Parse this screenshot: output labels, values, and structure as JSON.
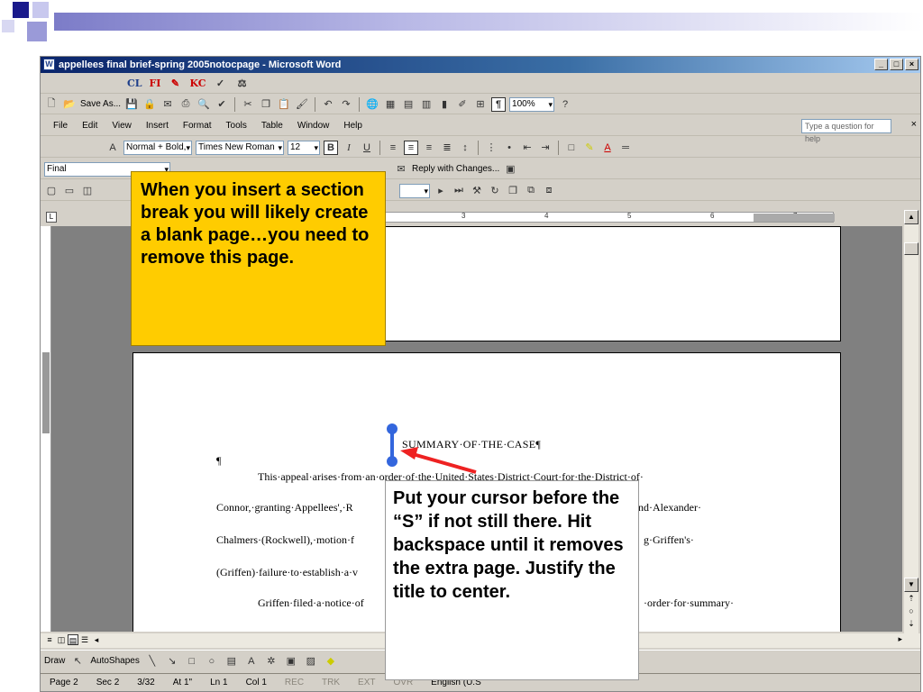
{
  "window": {
    "title": "appellees final brief-spring 2005notocpage - Microsoft Word",
    "min": "_",
    "max": "□",
    "close": "×"
  },
  "custom_toolbar": {
    "cl": "CL",
    "fi": "FI",
    "kc": "KC"
  },
  "standard_toolbar": {
    "save_as": "Save As...",
    "zoom": "100%"
  },
  "menu": [
    "File",
    "Edit",
    "View",
    "Insert",
    "Format",
    "Tools",
    "Table",
    "Window",
    "Help"
  ],
  "help": {
    "placeholder": "Type a question for help"
  },
  "format_toolbar": {
    "style": "Normal + Bold,",
    "font": "Times New Roman",
    "size": "12",
    "bold": "B",
    "italic": "I",
    "underline": "U"
  },
  "review_toolbar": {
    "display": "Final",
    "reply": "Reply with Changes..."
  },
  "ruler": {
    "marks": [
      "3",
      "4",
      "5",
      "6",
      "7"
    ]
  },
  "document": {
    "pilcrow": "¶",
    "title": "SUMMARY·OF·THE·CASE¶",
    "lines": [
      "This·appeal·arises·from·an·order·of·the·United·States·District·Court·for·the·District·of·",
      "Connor,·granting·Appellees',·R",
      "nd·Alexander·",
      "Chalmers·(Rockwell),·motion·f",
      "g·Griffen's·",
      "(Griffen)·failure·to·establish·a·v",
      "Griffen·filed·a·notice·of",
      "·order·for·summary·"
    ]
  },
  "draw_toolbar": {
    "draw": "Draw",
    "autoshapes": "AutoShapes"
  },
  "status": {
    "page": "Page 2",
    "sec": "Sec 2",
    "pages": "3/32",
    "at": "At 1\"",
    "ln": "Ln 1",
    "col": "Col 1",
    "rec": "REC",
    "trk": "TRK",
    "ext": "EXT",
    "ovr": "OVR",
    "lang": "English (U.S"
  },
  "callouts": {
    "yellow": "When you insert a section break you will likely create a blank page…you need to remove this page.",
    "white": "Put your cursor before the “S” if not still there. Hit backspace until it removes the extra page. Justify the title to center."
  },
  "colors": {
    "callout_yellow": "#ffcc00",
    "arrow": "#ee2222",
    "cursor": "#3366dd"
  }
}
